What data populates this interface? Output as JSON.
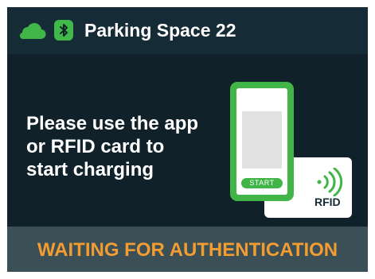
{
  "header": {
    "title": "Parking Space 22",
    "cloud_icon": "cloud-icon",
    "bluetooth_icon": "bluetooth-icon"
  },
  "instruction": {
    "lines": [
      "Please use the app",
      "or RFID card to",
      "start charging"
    ]
  },
  "illustration": {
    "phone_button_label": "START",
    "card_label": "RFID",
    "contactless_icon": "contactless-icon"
  },
  "status": {
    "text": "WAITING FOR AUTHENTICATION"
  },
  "colors": {
    "background": "#102129",
    "header": "#152b35",
    "accent_green": "#42b549",
    "status_orange": "#f29c32",
    "footer": "#3b4f57"
  }
}
